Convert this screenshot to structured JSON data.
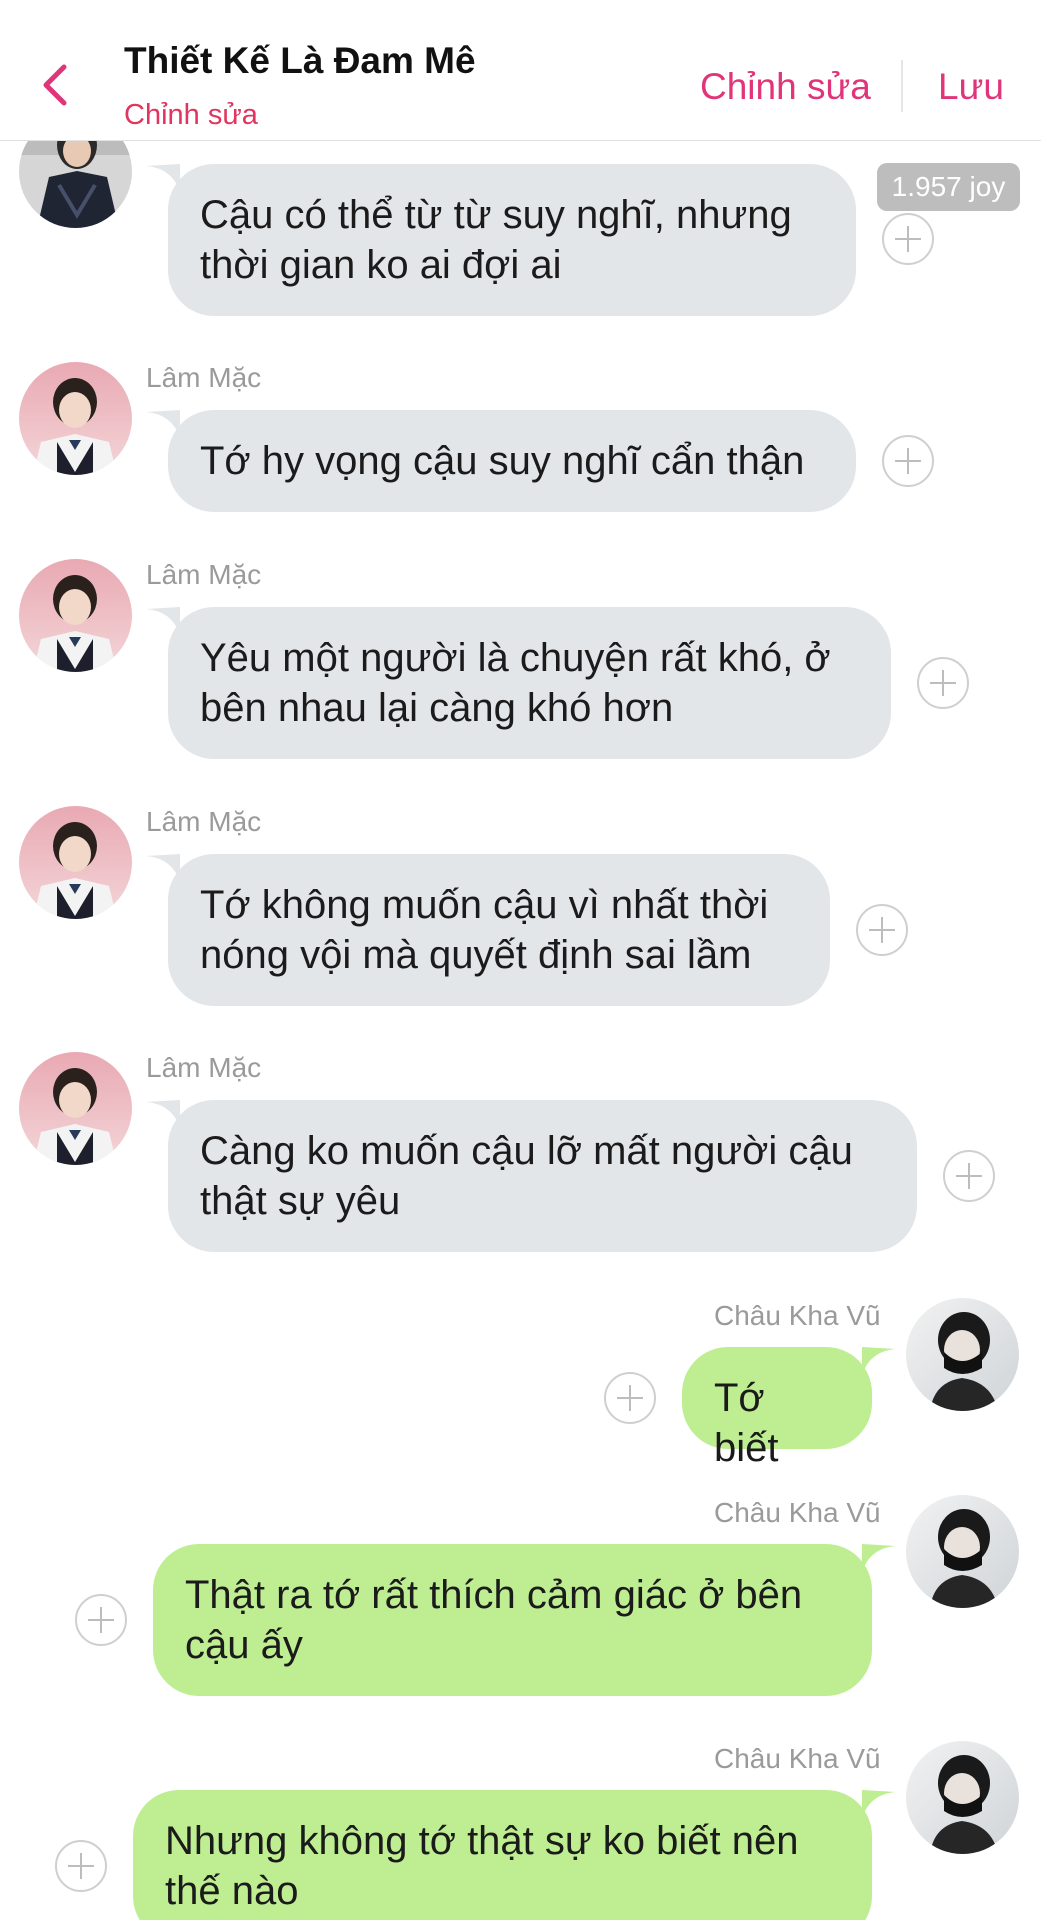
{
  "header": {
    "title": "Thiết Kế Là Đam Mê",
    "subtitle": "Chỉnh sửa",
    "edit_label": "Chỉnh sửa",
    "save_label": "Lưu",
    "back_icon": "chevron-left-icon"
  },
  "colors": {
    "accent": "#e0357a",
    "incoming_bubble": "#e3e6e9",
    "outgoing_bubble": "#bfee92"
  },
  "joy_badge": "1.957 joy",
  "messages": [
    {
      "sender": "",
      "text": "Cậu có thể từ từ suy nghĩ, nhưng thời gian ko ai đợi ai",
      "side": "in"
    },
    {
      "sender": "Lâm Mặc",
      "text": "Tớ hy vọng cậu suy nghĩ cẩn thận",
      "side": "in"
    },
    {
      "sender": "Lâm Mặc",
      "text": "Yêu một người là chuyện rất khó, ở bên nhau lại càng khó hơn",
      "side": "in"
    },
    {
      "sender": "Lâm Mặc",
      "text": "Tớ không muốn cậu vì nhất thời nóng vội mà quyết định sai lầm",
      "side": "in"
    },
    {
      "sender": "Lâm Mặc",
      "text": "Càng ko muốn cậu lỡ mất người cậu thật sự yêu",
      "side": "in"
    },
    {
      "sender": "Châu Kha Vũ",
      "text": "Tớ biết",
      "side": "out"
    },
    {
      "sender": "Châu Kha Vũ",
      "text": "Thật ra tớ rất thích cảm giác ở bên cậu ấy",
      "side": "out"
    },
    {
      "sender": "Châu Kha Vũ",
      "text": "Nhưng không tớ thật sự ko biết nên thế nào",
      "side": "out"
    }
  ]
}
